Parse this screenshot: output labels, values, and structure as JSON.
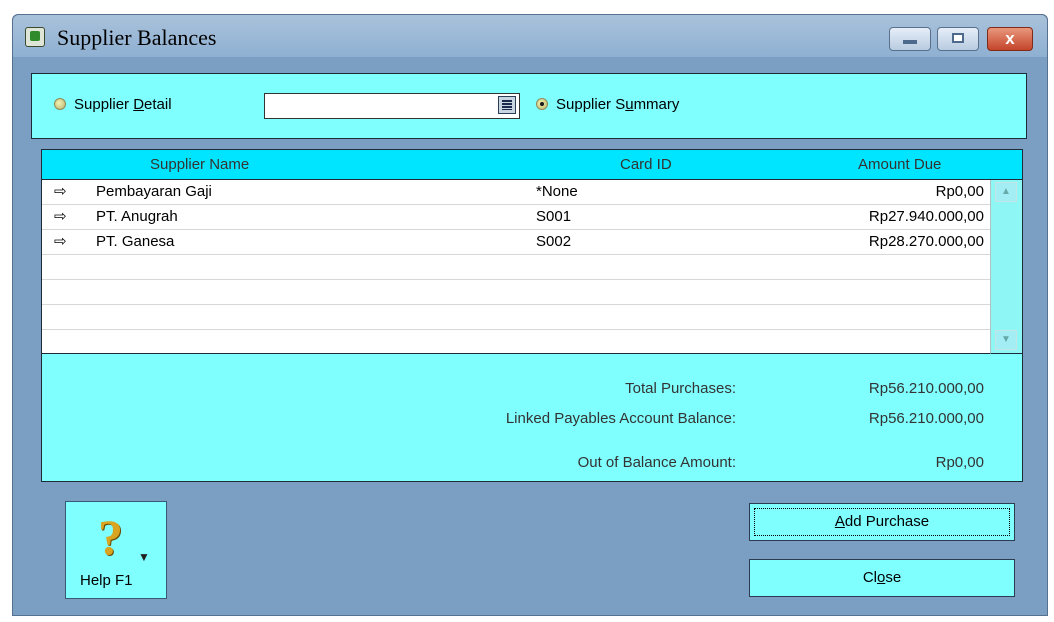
{
  "window": {
    "title": "Supplier Balances",
    "controls": {
      "close_glyph": "x"
    }
  },
  "filter": {
    "detail_label_pre": "Supplier ",
    "detail_label_key": "D",
    "detail_label_post": "etail",
    "supplier_select_value": "",
    "summary_label_pre": "Supplier S",
    "summary_label_key": "u",
    "summary_label_post": "mmary",
    "selected": "Supplier Summary"
  },
  "table": {
    "columns": [
      "Supplier Name",
      "Card ID",
      "Amount Due"
    ],
    "rows": [
      {
        "name": "Pembayaran Gaji",
        "card_id": "*None",
        "amount": "Rp0,00"
      },
      {
        "name": "PT. Anugrah",
        "card_id": "S001",
        "amount": "Rp27.940.000,00"
      },
      {
        "name": "PT. Ganesa",
        "card_id": "S002",
        "amount": "Rp28.270.000,00"
      }
    ],
    "row_arrow": "⇨"
  },
  "totals": {
    "total_purchases_label": "Total Purchases:",
    "total_purchases_value": "Rp56.210.000,00",
    "linked_label": "Linked Payables Account Balance:",
    "linked_value": "Rp56.210.000,00",
    "out_of_balance_label": "Out of Balance Amount:",
    "out_of_balance_value": "Rp0,00"
  },
  "buttons": {
    "help_label": "Help F1",
    "help_icon": "question-mark-icon",
    "help_glyph": "?",
    "help_caret": "▼",
    "add_pre": "",
    "add_key": "A",
    "add_post": "dd Purchase",
    "close_pre": "Cl",
    "close_key": "o",
    "close_post": "se"
  },
  "colors": {
    "panel": "#80ffff",
    "header": "#00e5ff",
    "frame": "#7b9ec3"
  }
}
